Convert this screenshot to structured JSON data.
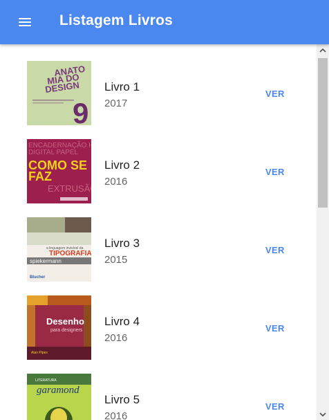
{
  "appbar": {
    "title": "Listagem Livros"
  },
  "books": [
    {
      "title": "Livro 1",
      "year": "2017",
      "action": "VER",
      "cover_text": "ANATOMIA DO DESIGN"
    },
    {
      "title": "Livro 2",
      "year": "2016",
      "action": "VER",
      "cover_text": "COMO SE FAZ"
    },
    {
      "title": "Livro 3",
      "year": "2015",
      "action": "VER",
      "cover_text": "TIPOGRAFIA"
    },
    {
      "title": "Livro 4",
      "year": "2016",
      "action": "VER",
      "cover_text": "Desenho"
    },
    {
      "title": "Livro 5",
      "year": "2016",
      "action": "VER",
      "cover_text": "garamond"
    }
  ],
  "colors": {
    "primary": "#4a87ee",
    "title_text": "#222222",
    "year_text": "#666666"
  },
  "icons": {
    "menu": "hamburger-menu-icon",
    "scroll_up": "chevron-up-icon",
    "scroll_down": "chevron-down-icon"
  }
}
